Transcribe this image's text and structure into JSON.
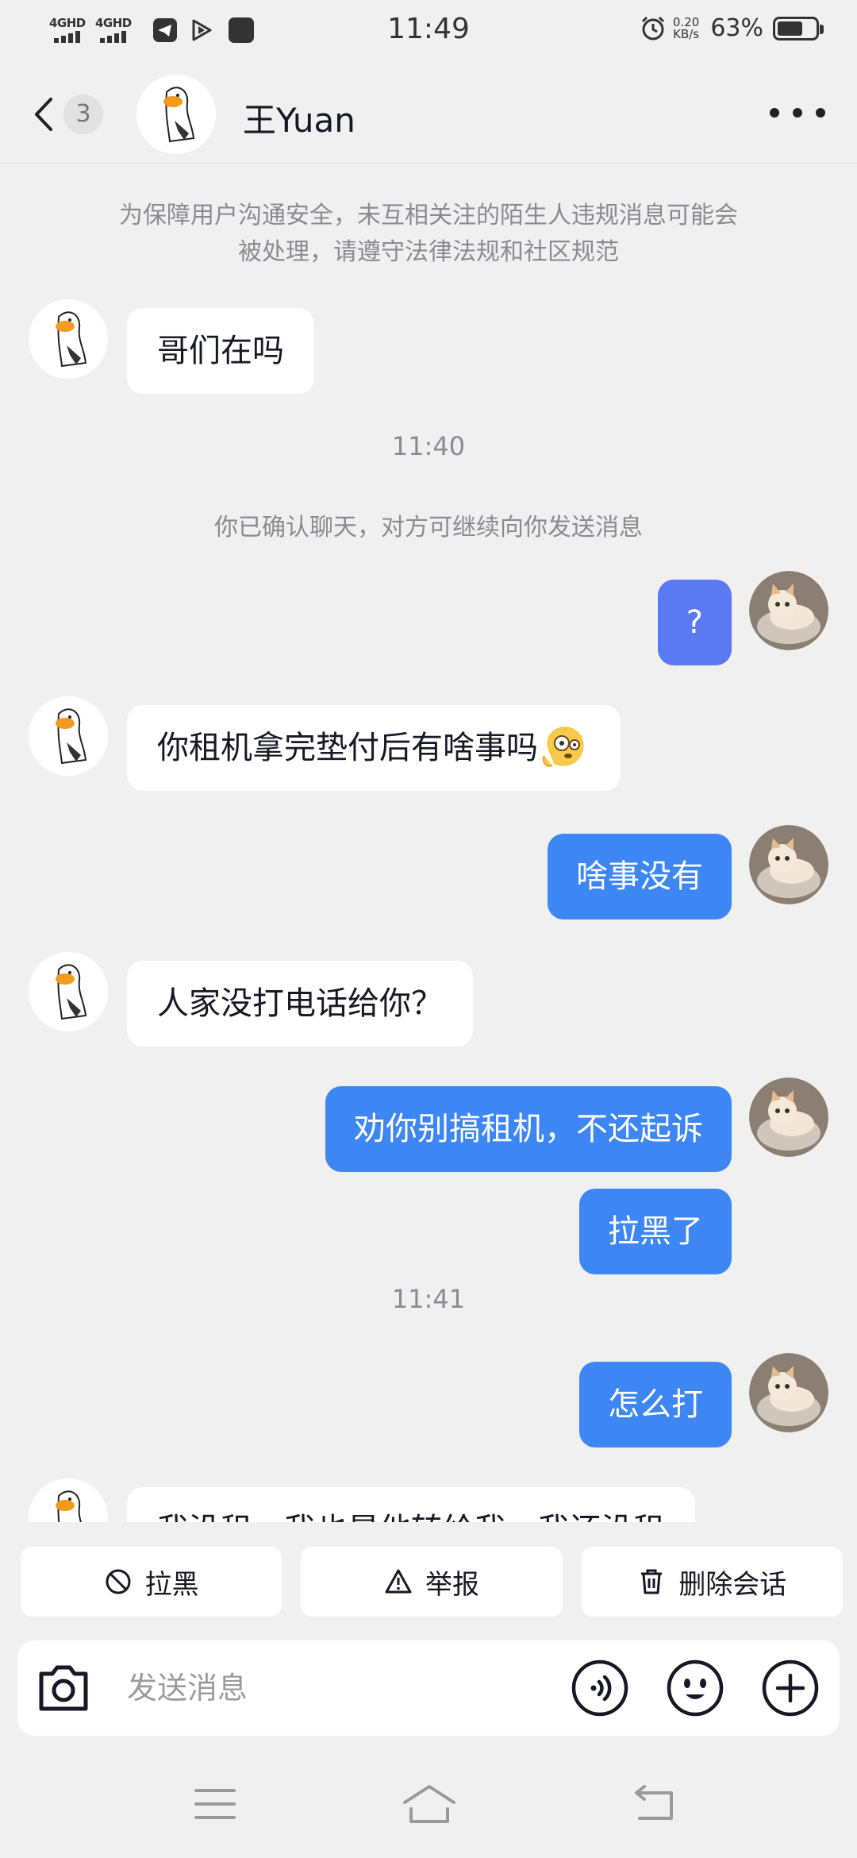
{
  "status_bar": {
    "network_1": "4GHD",
    "network_2": "4GHD",
    "time": "11:49",
    "speed_value": "0.20",
    "speed_unit": "KB/s",
    "battery_percent": "63%"
  },
  "header": {
    "unread_count": "3",
    "contact_name": "王Yuan"
  },
  "chat": {
    "notice": "为保障用户沟通安全，未互相关注的陌生人违规消息可能会被处理，请遵守法律法规和社区规范",
    "confirm_text": "你已确认聊天，对方可继续向你发送消息",
    "timestamps": [
      "11:40",
      "11:41"
    ],
    "messages": [
      {
        "from": "them",
        "text": "哥们在吗"
      },
      {
        "from": "me",
        "text": "?"
      },
      {
        "from": "them",
        "text": "你租机拿完垫付后有啥事吗"
      },
      {
        "from": "me",
        "text": "啥事没有"
      },
      {
        "from": "them",
        "text": "人家没打电话给你？"
      },
      {
        "from": "me",
        "text": "劝你别搞租机，不还起诉"
      },
      {
        "from": "me",
        "text": "拉黑了"
      },
      {
        "from": "me",
        "text": "怎么打"
      },
      {
        "from": "them",
        "text": "我没租，我也是他转给我，我还没租"
      }
    ]
  },
  "actions": {
    "block": "拉黑",
    "report": "举报",
    "delete": "删除会话"
  },
  "input": {
    "placeholder": "发送消息"
  },
  "colors": {
    "background": "#f0f0f0",
    "outgoing_bubble": "#3d86f4",
    "incoming_bubble": "#ffffff",
    "system_text": "#8a8b91"
  },
  "icons": [
    "back-chevron-icon",
    "more-dots-icon",
    "block-icon",
    "warning-icon",
    "trash-icon",
    "camera-icon",
    "voice-icon",
    "emoji-icon",
    "plus-icon",
    "menu-icon",
    "home-icon",
    "back-icon"
  ]
}
